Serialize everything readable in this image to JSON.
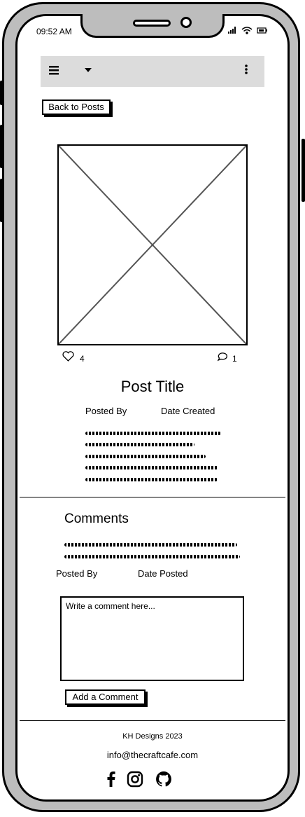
{
  "status_bar": {
    "time": "09:52 AM",
    "icons": "▮▮▮ ᯤ ▭"
  },
  "app_bar": {
    "menu_icon": "hamburger-icon",
    "dropdown_icon": "caret-down-icon",
    "more_icon": "kebab-icon"
  },
  "back_button": {
    "label": "Back to Posts"
  },
  "post": {
    "likes": "4",
    "comments": "1",
    "title": "Post Title",
    "posted_by": "Posted By",
    "date_created": "Date Created"
  },
  "comments_section": {
    "heading": "Comments",
    "posted_by": "Posted By",
    "date_posted": "Date Posted",
    "textarea_placeholder": "Write a comment here...",
    "add_button": "Add a Comment"
  },
  "footer": {
    "copyright": "KH Designs 2023",
    "email": "info@thecraftcafe.com",
    "social_icons": [
      "facebook-icon",
      "instagram-icon",
      "github-icon"
    ]
  }
}
